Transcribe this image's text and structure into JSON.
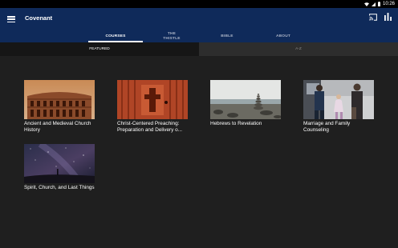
{
  "status": {
    "time": "10:26"
  },
  "appbar": {
    "title": "Covenant"
  },
  "tabs": [
    {
      "label": "COURSES"
    },
    {
      "label": "THE\nTHISTLE"
    },
    {
      "label": "BIBLE"
    },
    {
      "label": "ABOUT"
    }
  ],
  "subtabs": [
    {
      "label": "FEATURED"
    },
    {
      "label": "A-Z"
    }
  ],
  "courses": [
    {
      "title": "Ancient and Medieval Church History"
    },
    {
      "title": "Christ-Centered Preaching: Preparation and Delivery o..."
    },
    {
      "title": "Hebrews to Revelation"
    },
    {
      "title": "Marriage and Family Counseling"
    },
    {
      "title": "Spirit, Church, and Last Things"
    }
  ],
  "icons": {
    "menu": "menu-icon",
    "cast": "cast-icon",
    "stats": "bar-chart-icon"
  }
}
